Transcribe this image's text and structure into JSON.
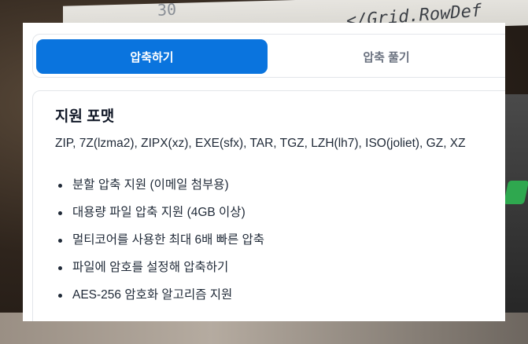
{
  "tabs": [
    {
      "label": "압축하기",
      "active": true
    },
    {
      "label": "압축 풀기",
      "active": false
    }
  ],
  "formats_card": {
    "title": "지원 포맷",
    "formats_line": "ZIP, 7Z(lzma2), ZIPX(xz), EXE(sfx), TAR, TGZ, LZH(lh7), ISO(joliet), GZ, XZ",
    "features": [
      "분할 압축 지원 (이메일 첨부용)",
      "대용량 파일 압축 지원 (4GB 이상)",
      "멀티코어를 사용한 최대 6배 빠른 압축",
      "파일에 암호를 설정해 압축하기",
      "AES-256 암호화 알고리즘 지원"
    ]
  },
  "background": {
    "code_fragment_left": "30",
    "code_fragment_right": "</Grid.RowDef"
  },
  "colors": {
    "accent": "#0a74de",
    "panel_background": "#ffffff",
    "border": "#e3e6ea",
    "inactive_tab_text": "#6b7280"
  }
}
